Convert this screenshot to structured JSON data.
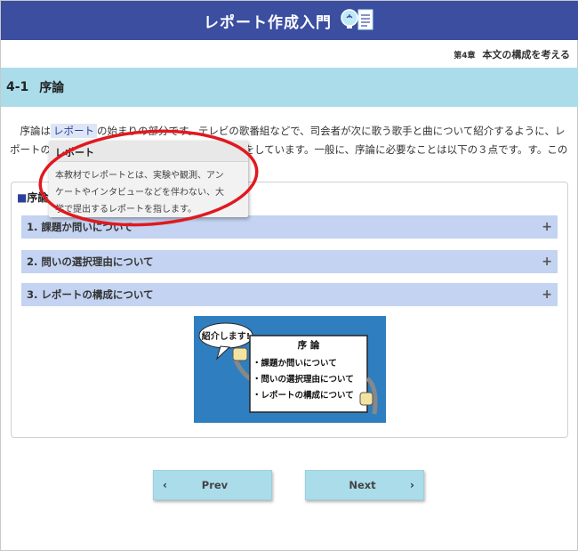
{
  "header": {
    "title": "レポート作成入門",
    "icon": "lightbulb-document-icon"
  },
  "chapter": {
    "label": "第4章",
    "title": "本文の構成を考える"
  },
  "section": {
    "number": "4-1",
    "title": "序論"
  },
  "intro": {
    "before": "序論は",
    "term": "レポート",
    "line1_after": "の始まりの部分です。テレビの歌番組などで、司会者が次に歌う歌手と曲について紹介するように、レポ",
    "line2_start": "ートの序",
    "line2_end": "介」する役目をしています。一般に、序論に必要なことは以下の３点です。",
    "line3_start": "す。この"
  },
  "panel": {
    "title": "序論",
    "accordions": [
      {
        "label": "1. 課題か問いについて",
        "toggle": "+"
      },
      {
        "label": "2. 問いの選択理由について",
        "toggle": "+"
      },
      {
        "label": "3. レポートの構成について",
        "toggle": "+"
      }
    ]
  },
  "illustration": {
    "bubble": "紹介します!",
    "board_title": "序 論",
    "board_items": [
      "・課題か問いについて",
      "・問いの選択理由について",
      "・レポートの構成について"
    ],
    "colors": {
      "background": "#2f7fc0",
      "board": "#ffffff"
    }
  },
  "tooltip": {
    "title": "レポート",
    "body_lines": [
      "本教材でレポートとは、実験や観測、アン",
      "ケートやインタビューなどを伴わない、大",
      "学で提出するレポートを指します。"
    ]
  },
  "nav": {
    "prev": "Prev",
    "next": "Next"
  },
  "colors": {
    "header": "#3b4ea0",
    "section": "#aadcea",
    "accordion": "#c3d3f1",
    "annotation": "#e0191f"
  }
}
